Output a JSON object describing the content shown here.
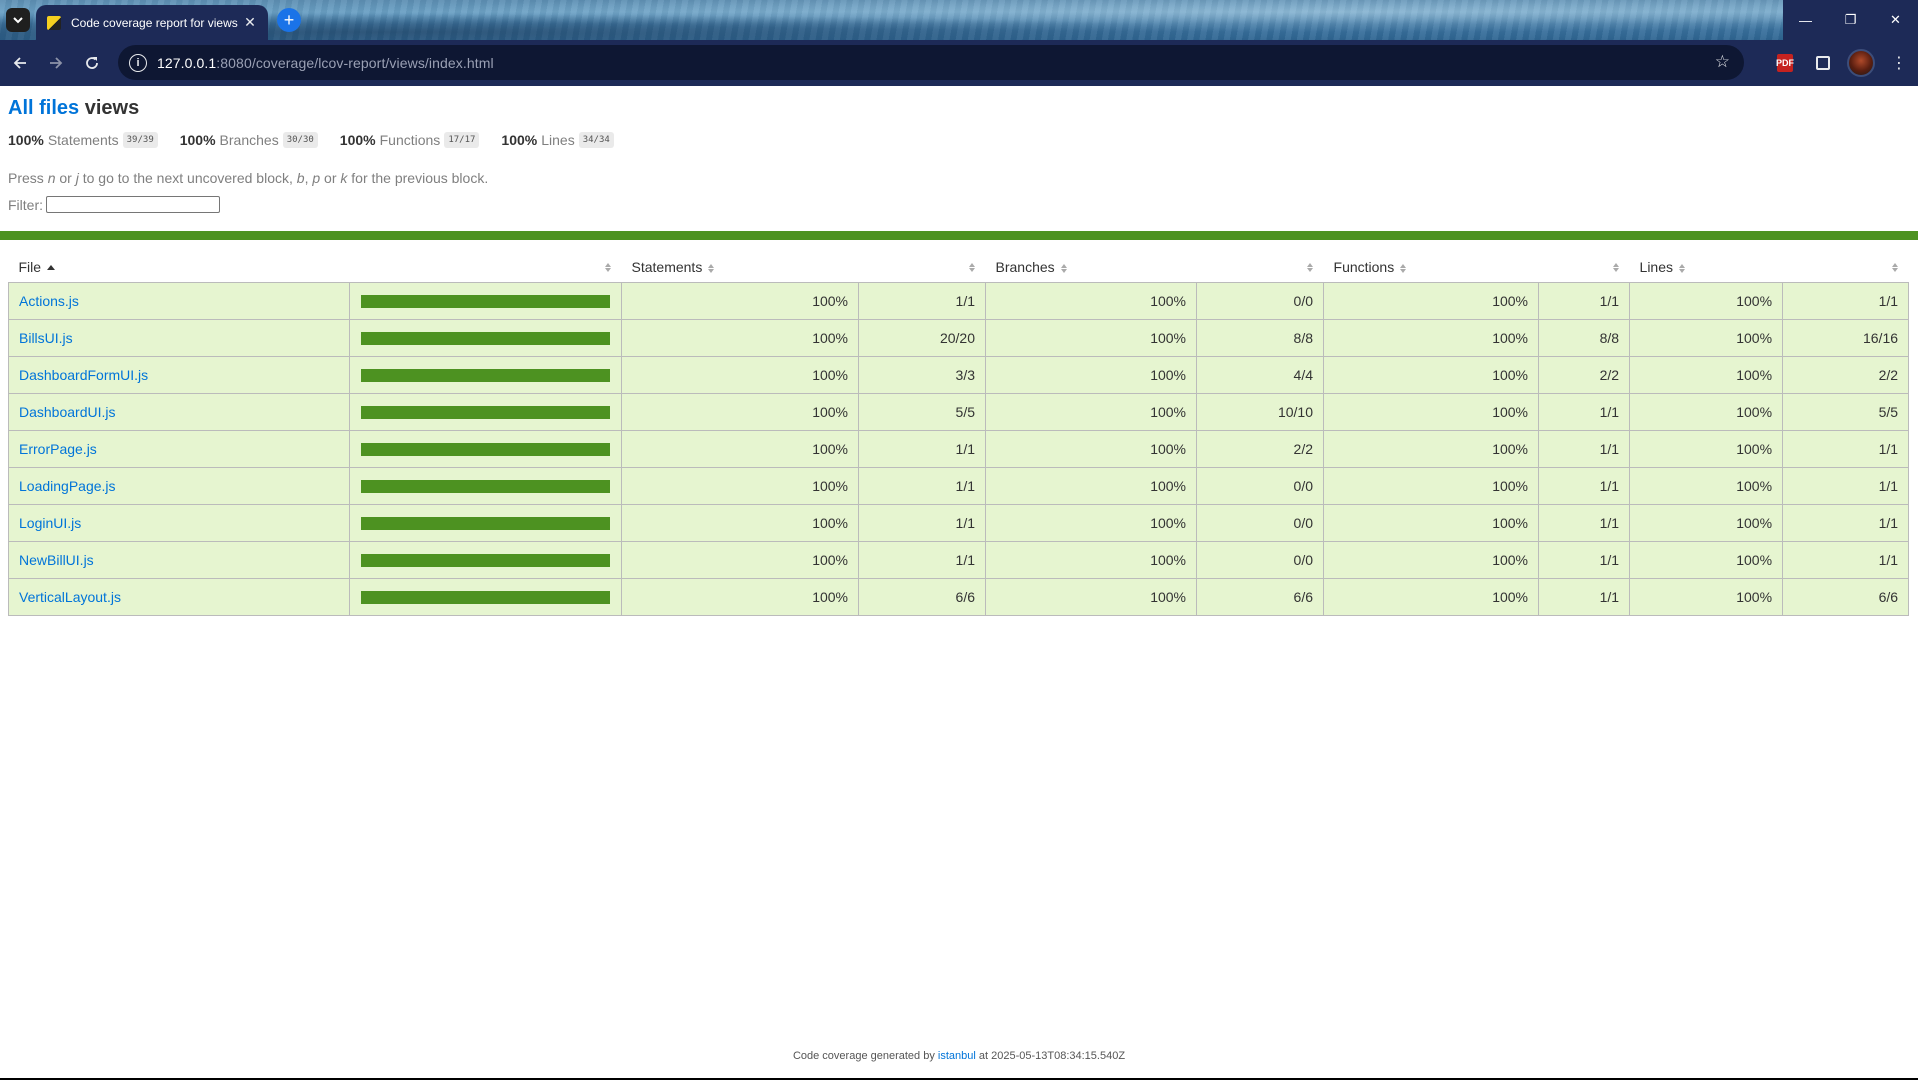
{
  "browser": {
    "tab_title": "Code coverage report for views",
    "tab_close": "✕",
    "new_tab": "+",
    "url_host": "127.0.0.1",
    "url_rest": ":8080/coverage/lcov-report/views/index.html",
    "window": {
      "minimize": "—",
      "restore": "❐",
      "close": "✕"
    },
    "pdf_label": "PDF",
    "icons": [
      "tab-list-icon",
      "back-icon",
      "forward-icon",
      "reload-icon",
      "site-info-icon",
      "bookmark-star-icon",
      "pdf-extension-icon",
      "extensions-puzzle-icon",
      "profile-avatar",
      "more-menu-icon"
    ]
  },
  "header": {
    "all_files_link": "All files",
    "current_dir": "views"
  },
  "summary": [
    {
      "pct": "100%",
      "label": "Statements",
      "fraction": "39/39"
    },
    {
      "pct": "100%",
      "label": "Branches",
      "fraction": "30/30"
    },
    {
      "pct": "100%",
      "label": "Functions",
      "fraction": "17/17"
    },
    {
      "pct": "100%",
      "label": "Lines",
      "fraction": "34/34"
    }
  ],
  "hint": {
    "p1": "Press ",
    "n": "n",
    "p2": " or ",
    "j": "j",
    "p3": " to go to the next uncovered block, ",
    "b": "b",
    "p4": ", ",
    "p": "p",
    "p5": " or ",
    "k": "k",
    "p6": " for the previous block."
  },
  "filter": {
    "label": "Filter:",
    "value": ""
  },
  "status_color": "#4d9221",
  "table": {
    "headers": {
      "file": "File",
      "statements": "Statements",
      "branches": "Branches",
      "functions": "Functions",
      "lines": "Lines"
    },
    "rows": [
      {
        "file": "Actions.js",
        "coverage": 1.0,
        "stmt_pct": "100%",
        "stmt": "1/1",
        "br_pct": "100%",
        "br": "0/0",
        "fn_pct": "100%",
        "fn": "1/1",
        "ln_pct": "100%",
        "ln": "1/1"
      },
      {
        "file": "BillsUI.js",
        "coverage": 1.0,
        "stmt_pct": "100%",
        "stmt": "20/20",
        "br_pct": "100%",
        "br": "8/8",
        "fn_pct": "100%",
        "fn": "8/8",
        "ln_pct": "100%",
        "ln": "16/16"
      },
      {
        "file": "DashboardFormUI.js",
        "coverage": 1.0,
        "stmt_pct": "100%",
        "stmt": "3/3",
        "br_pct": "100%",
        "br": "4/4",
        "fn_pct": "100%",
        "fn": "2/2",
        "ln_pct": "100%",
        "ln": "2/2"
      },
      {
        "file": "DashboardUI.js",
        "coverage": 1.0,
        "stmt_pct": "100%",
        "stmt": "5/5",
        "br_pct": "100%",
        "br": "10/10",
        "fn_pct": "100%",
        "fn": "1/1",
        "ln_pct": "100%",
        "ln": "5/5"
      },
      {
        "file": "ErrorPage.js",
        "coverage": 1.0,
        "stmt_pct": "100%",
        "stmt": "1/1",
        "br_pct": "100%",
        "br": "2/2",
        "fn_pct": "100%",
        "fn": "1/1",
        "ln_pct": "100%",
        "ln": "1/1"
      },
      {
        "file": "LoadingPage.js",
        "coverage": 1.0,
        "stmt_pct": "100%",
        "stmt": "1/1",
        "br_pct": "100%",
        "br": "0/0",
        "fn_pct": "100%",
        "fn": "1/1",
        "ln_pct": "100%",
        "ln": "1/1"
      },
      {
        "file": "LoginUI.js",
        "coverage": 1.0,
        "stmt_pct": "100%",
        "stmt": "1/1",
        "br_pct": "100%",
        "br": "0/0",
        "fn_pct": "100%",
        "fn": "1/1",
        "ln_pct": "100%",
        "ln": "1/1"
      },
      {
        "file": "NewBillUI.js",
        "coverage": 1.0,
        "stmt_pct": "100%",
        "stmt": "1/1",
        "br_pct": "100%",
        "br": "0/0",
        "fn_pct": "100%",
        "fn": "1/1",
        "ln_pct": "100%",
        "ln": "1/1"
      },
      {
        "file": "VerticalLayout.js",
        "coverage": 1.0,
        "stmt_pct": "100%",
        "stmt": "6/6",
        "br_pct": "100%",
        "br": "6/6",
        "fn_pct": "100%",
        "fn": "1/1",
        "ln_pct": "100%",
        "ln": "6/6"
      }
    ]
  },
  "footer": {
    "prefix": "Code coverage generated by ",
    "link": "istanbul",
    "suffix": " at 2025-05-13T08:34:15.540Z"
  }
}
